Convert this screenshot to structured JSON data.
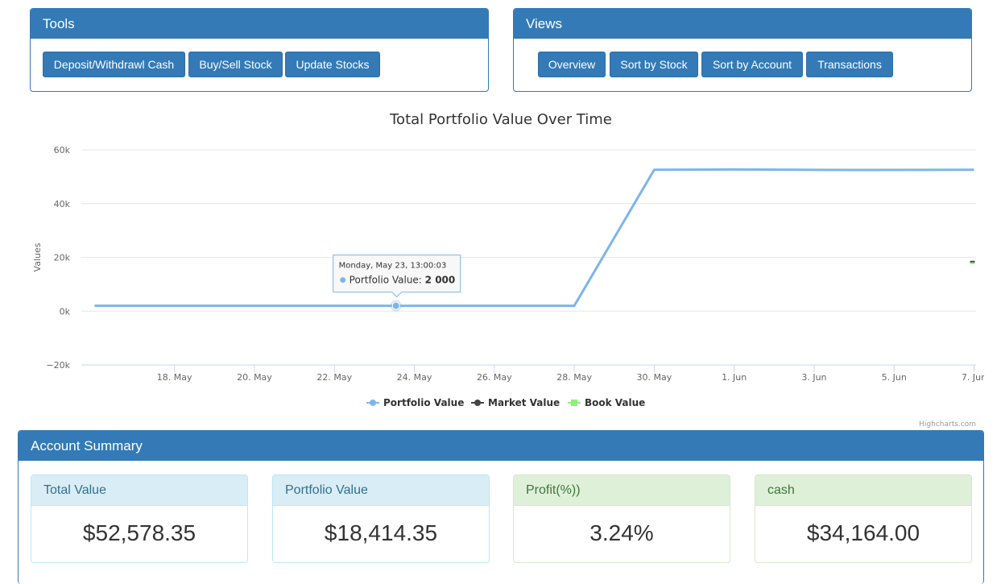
{
  "tools": {
    "title": "Tools",
    "buttons": [
      "Deposit/Withdrawl Cash",
      "Buy/Sell Stock",
      "Update Stocks"
    ]
  },
  "views": {
    "title": "Views",
    "buttons": [
      "Overview",
      "Sort by Stock",
      "Sort by Account",
      "Transactions"
    ]
  },
  "chart_data": {
    "type": "line",
    "title": "Total Portfolio Value Over Time",
    "ylabel": "Values",
    "xlabel": "",
    "ylim": [
      -20000,
      60000
    ],
    "xlim": [
      "2016-05-16",
      "2016-06-07"
    ],
    "y_ticks": [
      "60k",
      "40k",
      "20k",
      "0k",
      "−20k"
    ],
    "x_ticks": [
      "18. May",
      "20. May",
      "22. May",
      "24. May",
      "26. May",
      "28. May",
      "30. May",
      "1. Jun",
      "3. Jun",
      "5. Jun",
      "7. Jun"
    ],
    "grid": true,
    "legend_placement": "bottom-center",
    "series": [
      {
        "name": "Portfolio Value",
        "color": "#7cb5ec",
        "points": [
          {
            "x": "2016-05-16",
            "y": 2000
          },
          {
            "x": "2016-05-23",
            "y": 2000
          },
          {
            "x": "2016-05-28",
            "y": 2000
          },
          {
            "x": "2016-05-30",
            "y": 52600
          },
          {
            "x": "2016-06-01",
            "y": 52700
          },
          {
            "x": "2016-06-04",
            "y": 52500
          },
          {
            "x": "2016-06-07",
            "y": 52578
          }
        ]
      },
      {
        "name": "Market Value",
        "color": "#434348",
        "points": [
          {
            "x": "2016-06-07",
            "y": 18414
          }
        ]
      },
      {
        "name": "Book Value",
        "color": "#90ed7d",
        "points": [
          {
            "x": "2016-06-07",
            "y": 17800
          }
        ]
      }
    ],
    "tooltip": {
      "header": "Monday, May 23, 13:00:03",
      "series_label": "Portfolio Value: ",
      "value_text": "2 000",
      "x": "2016-05-23",
      "y": 2000
    },
    "credits": "Highcharts.com"
  },
  "summary": {
    "title": "Account Summary",
    "stats": [
      {
        "label": "Total Value",
        "value": "$52,578.35"
      },
      {
        "label": "Portfolio Value",
        "value": "$18,414.35"
      },
      {
        "label": "Profit(%))",
        "value": "3.24%"
      },
      {
        "label": "cash",
        "value": "$34,164.00"
      }
    ]
  }
}
